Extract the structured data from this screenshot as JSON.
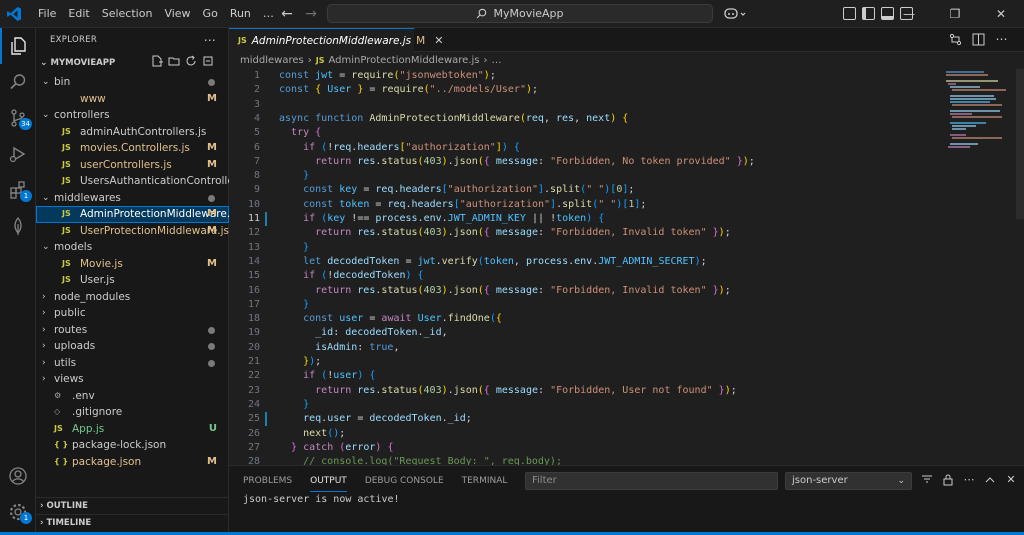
{
  "titlebar": {
    "menu": [
      "File",
      "Edit",
      "Selection",
      "View",
      "Go",
      "Run",
      "…"
    ],
    "search_label": "MyMovieApp"
  },
  "activitybar": {
    "source_control_badge": "34",
    "extensions_badge": "1",
    "accounts_badge": "1"
  },
  "sidebar": {
    "header": "EXPLORER",
    "project": "MYMOVIEAPP",
    "outline": "OUTLINE",
    "timeline": "TIMELINE",
    "tree": [
      {
        "label": "bin",
        "type": "folder",
        "depth": 0,
        "status": "dot"
      },
      {
        "label": "www",
        "type": "file",
        "icon": "",
        "depth": 1,
        "status": "M"
      },
      {
        "label": "controllers",
        "type": "folder",
        "depth": 0,
        "status": ""
      },
      {
        "label": "adminAuthControllers.js",
        "type": "file",
        "icon": "JS",
        "depth": 1,
        "status": ""
      },
      {
        "label": "movies.Controllers.js",
        "type": "file",
        "icon": "JS",
        "depth": 1,
        "status": "M"
      },
      {
        "label": "userControllers.js",
        "type": "file",
        "icon": "JS",
        "depth": 1,
        "status": "M"
      },
      {
        "label": "UsersAuthanticationController.js",
        "type": "file",
        "icon": "JS",
        "depth": 1,
        "status": ""
      },
      {
        "label": "middlewares",
        "type": "folder",
        "depth": 0,
        "status": "dot"
      },
      {
        "label": "AdminProtectionMiddleware.js",
        "type": "file",
        "icon": "JS",
        "depth": 1,
        "status": "M",
        "selected": true
      },
      {
        "label": "UserProtectionMiddleware.js",
        "type": "file",
        "icon": "JS",
        "depth": 1,
        "status": "M"
      },
      {
        "label": "models",
        "type": "folder",
        "depth": 0,
        "status": ""
      },
      {
        "label": "Movie.js",
        "type": "file",
        "icon": "JS",
        "depth": 1,
        "status": "M"
      },
      {
        "label": "User.js",
        "type": "file",
        "icon": "JS",
        "depth": 1,
        "status": ""
      },
      {
        "label": "node_modules",
        "type": "folder-closed",
        "depth": 0,
        "status": ""
      },
      {
        "label": "public",
        "type": "folder-closed",
        "depth": 0,
        "status": ""
      },
      {
        "label": "routes",
        "type": "folder-closed",
        "depth": 0,
        "status": "dot"
      },
      {
        "label": "uploads",
        "type": "folder-closed",
        "depth": 0,
        "status": "dot"
      },
      {
        "label": "utils",
        "type": "folder-closed",
        "depth": 0,
        "status": "dot"
      },
      {
        "label": "views",
        "type": "folder-closed",
        "depth": 0,
        "status": ""
      },
      {
        "label": ".env",
        "type": "file",
        "icon": "env",
        "depth": 0,
        "status": ""
      },
      {
        "label": ".gitignore",
        "type": "file",
        "icon": "git",
        "depth": 0,
        "status": ""
      },
      {
        "label": "App.js",
        "type": "file",
        "icon": "JS",
        "depth": 0,
        "status": "U"
      },
      {
        "label": "package-lock.json",
        "type": "file",
        "icon": "{}",
        "depth": 0,
        "status": ""
      },
      {
        "label": "package.json",
        "type": "file",
        "icon": "{}",
        "depth": 0,
        "status": "M"
      }
    ]
  },
  "editor": {
    "tab_icon": "JS",
    "tab_label": "AdminProtectionMiddleware.js",
    "tab_status": "M",
    "breadcrumb": [
      "middlewares",
      "AdminProtectionMiddleware.js",
      "…"
    ],
    "current_line": 11,
    "lines": [
      {
        "n": 1,
        "h": "<span class='kw'>const</span> <span class='cst'>jwt</span> <span class='pl'>=</span> <span class='fn'>require</span><span class='b1'>(</span><span class='str'>\"jsonwebtoken\"</span><span class='b1'>)</span><span class='pl'>;</span>"
      },
      {
        "n": 2,
        "h": "<span class='kw'>const</span> <span class='b1'>{</span> <span class='cst'>User</span> <span class='b1'>}</span> <span class='pl'>=</span> <span class='fn'>require</span><span class='b1'>(</span><span class='str'>\"../models/User\"</span><span class='b1'>)</span><span class='pl'>;</span>"
      },
      {
        "n": 3,
        "h": ""
      },
      {
        "n": 4,
        "h": "<span class='kw'>async</span> <span class='kw'>function</span> <span class='fn'>AdminProtectionMiddleware</span><span class='b1'>(</span><span class='var'>req</span><span class='pl'>,</span> <span class='var'>res</span><span class='pl'>,</span> <span class='var'>next</span><span class='b1'>)</span> <span class='b1'>{</span>"
      },
      {
        "n": 5,
        "h": "  <span class='ctl'>try</span> <span class='b2'>{</span>"
      },
      {
        "n": 6,
        "h": "    <span class='ctl'>if</span> <span class='b3'>(</span><span class='pl'>!</span><span class='var'>req</span><span class='pl'>.</span><span class='var'>headers</span><span class='b1'>[</span><span class='str'>\"authorization\"</span><span class='b1'>]</span><span class='b3'>)</span> <span class='b3'>{</span>"
      },
      {
        "n": 7,
        "h": "      <span class='ctl'>return</span> <span class='var'>res</span><span class='pl'>.</span><span class='fn'>status</span><span class='b1'>(</span><span class='num'>403</span><span class='b1'>)</span><span class='pl'>.</span><span class='fn'>json</span><span class='b1'>(</span><span class='b2'>{</span> <span class='var'>message</span><span class='pl'>:</span> <span class='str'>\"Forbidden, No token provided\"</span> <span class='b2'>}</span><span class='b1'>)</span><span class='pl'>;</span>"
      },
      {
        "n": 8,
        "h": "    <span class='b3'>}</span>"
      },
      {
        "n": 9,
        "h": "    <span class='kw'>const</span> <span class='cst'>key</span> <span class='pl'>=</span> <span class='var'>req</span><span class='pl'>.</span><span class='var'>headers</span><span class='b3'>[</span><span class='str'>\"authorization\"</span><span class='b3'>]</span><span class='pl'>.</span><span class='fn'>split</span><span class='b3'>(</span><span class='str'>\" \"</span><span class='b3'>)</span><span class='b3'>[</span><span class='num'>0</span><span class='b3'>]</span><span class='pl'>;</span>"
      },
      {
        "n": 10,
        "h": "    <span class='kw'>const</span> <span class='cst'>token</span> <span class='pl'>=</span> <span class='var'>req</span><span class='pl'>.</span><span class='var'>headers</span><span class='b3'>[</span><span class='str'>\"authorization\"</span><span class='b3'>]</span><span class='pl'>.</span><span class='fn'>split</span><span class='b3'>(</span><span class='str'>\" \"</span><span class='b3'>)</span><span class='b3'>[</span><span class='num'>1</span><span class='b3'>]</span><span class='pl'>;</span>"
      },
      {
        "n": 11,
        "h": "    <span class='ctl'>if</span> <span class='b3'>(</span><span class='cst'>key</span> <span class='pl'>!==</span> <span class='var'>process</span><span class='pl'>.</span><span class='var'>env</span><span class='pl'>.</span><span class='cst'>JWT_ADMIN_KEY</span> <span class='pl'>||</span> <span class='pl'>!</span><span class='cst'>token</span><span class='b3'>)</span> <span class='b3'>{</span>"
      },
      {
        "n": 12,
        "h": "      <span class='ctl'>return</span> <span class='var'>res</span><span class='pl'>.</span><span class='fn'>status</span><span class='b1'>(</span><span class='num'>403</span><span class='b1'>)</span><span class='pl'>.</span><span class='fn'>json</span><span class='b1'>(</span><span class='b2'>{</span> <span class='var'>message</span><span class='pl'>:</span> <span class='str'>\"Forbidden, Invalid token\"</span> <span class='b2'>}</span><span class='b1'>)</span><span class='pl'>;</span>"
      },
      {
        "n": 13,
        "h": "    <span class='b3'>}</span>"
      },
      {
        "n": 14,
        "h": "    <span class='kw'>let</span> <span class='var'>decodedToken</span> <span class='pl'>=</span> <span class='cst'>jwt</span><span class='pl'>.</span><span class='fn'>verify</span><span class='b3'>(</span><span class='cst'>token</span><span class='pl'>,</span> <span class='var'>process</span><span class='pl'>.</span><span class='var'>env</span><span class='pl'>.</span><span class='cst'>JWT_ADMIN_SECRET</span><span class='b3'>)</span><span class='pl'>;</span>"
      },
      {
        "n": 15,
        "h": "    <span class='ctl'>if</span> <span class='b3'>(</span><span class='pl'>!</span><span class='var'>decodedToken</span><span class='b3'>)</span> <span class='b3'>{</span>"
      },
      {
        "n": 16,
        "h": "      <span class='ctl'>return</span> <span class='var'>res</span><span class='pl'>.</span><span class='fn'>status</span><span class='b1'>(</span><span class='num'>403</span><span class='b1'>)</span><span class='pl'>.</span><span class='fn'>json</span><span class='b1'>(</span><span class='b2'>{</span> <span class='var'>message</span><span class='pl'>:</span> <span class='str'>\"Forbidden, Invalid token\"</span> <span class='b2'>}</span><span class='b1'>)</span><span class='pl'>;</span>"
      },
      {
        "n": 17,
        "h": "    <span class='b3'>}</span>"
      },
      {
        "n": 18,
        "h": "    <span class='kw'>const</span> <span class='cst'>user</span> <span class='pl'>=</span> <span class='ctl'>await</span> <span class='cst'>User</span><span class='pl'>.</span><span class='fn'>findOne</span><span class='b3'>(</span><span class='b1'>{</span>"
      },
      {
        "n": 19,
        "h": "      <span class='var'>_id</span><span class='pl'>:</span> <span class='var'>decodedToken</span><span class='pl'>.</span><span class='var'>_id</span><span class='pl'>,</span>"
      },
      {
        "n": 20,
        "h": "      <span class='var'>isAdmin</span><span class='pl'>:</span> <span class='kw'>true</span><span class='pl'>,</span>"
      },
      {
        "n": 21,
        "h": "    <span class='b1'>}</span><span class='b3'>)</span><span class='pl'>;</span>"
      },
      {
        "n": 22,
        "h": "    <span class='ctl'>if</span> <span class='b3'>(</span><span class='pl'>!</span><span class='cst'>user</span><span class='b3'>)</span> <span class='b3'>{</span>"
      },
      {
        "n": 23,
        "h": "      <span class='ctl'>return</span> <span class='var'>res</span><span class='pl'>.</span><span class='fn'>status</span><span class='b1'>(</span><span class='num'>403</span><span class='b1'>)</span><span class='pl'>.</span><span class='fn'>json</span><span class='b1'>(</span><span class='b2'>{</span> <span class='var'>message</span><span class='pl'>:</span> <span class='str'>\"Forbidden, User not found\"</span> <span class='b2'>}</span><span class='b1'>)</span><span class='pl'>;</span>"
      },
      {
        "n": 24,
        "h": "    <span class='b3'>}</span>"
      },
      {
        "n": 25,
        "h": "    <span class='var'>req</span><span class='pl'>.</span><span class='var'>user</span> <span class='pl'>=</span> <span class='var'>decodedToken</span><span class='pl'>.</span><span class='var'>_id</span><span class='pl'>;</span>"
      },
      {
        "n": 26,
        "h": "    <span class='fn'>next</span><span class='b3'>()</span><span class='pl'>;</span>"
      },
      {
        "n": 27,
        "h": "  <span class='b2'>}</span> <span class='ctl'>catch</span> <span class='b2'>(</span><span class='var'>error</span><span class='b2'>)</span> <span class='b2'>{</span>"
      },
      {
        "n": 28,
        "h": "    <span class='cmt'>// console.log(\"Request Body: \", req.body);</span>"
      }
    ]
  },
  "panel": {
    "tabs": [
      "PROBLEMS",
      "OUTPUT",
      "DEBUG CONSOLE",
      "TERMINAL",
      "PORTS"
    ],
    "active_tab": "OUTPUT",
    "filter_placeholder": "Filter",
    "channel": "json-server",
    "output": "json-server is now active!"
  }
}
